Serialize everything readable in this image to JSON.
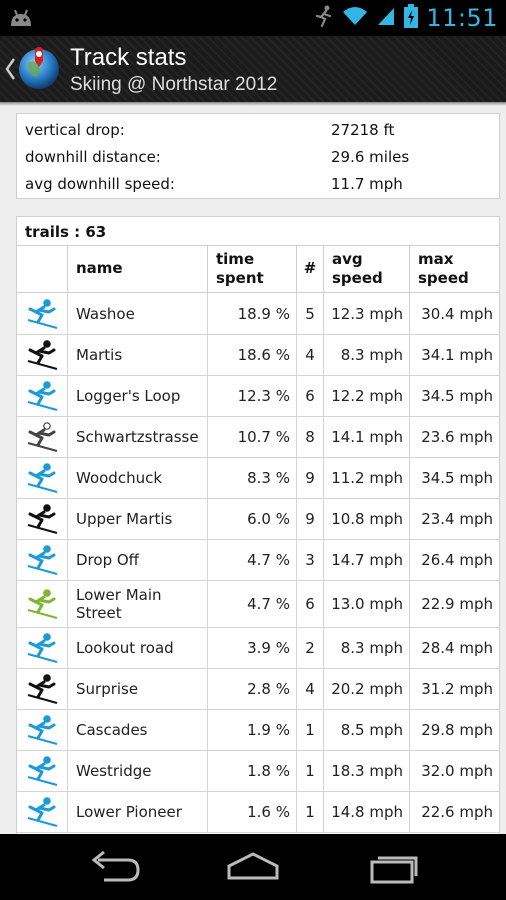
{
  "status_bar": {
    "time": "11:51",
    "icons": [
      "android-debug-icon",
      "running-activity-icon",
      "wifi-icon",
      "cell-signal-icon",
      "battery-charging-icon"
    ]
  },
  "action_bar": {
    "title": "Track stats",
    "subtitle": "Skiing @ Northstar 2012",
    "icons": [
      "up-chevron-icon",
      "app-globe-logo-icon"
    ]
  },
  "summary": [
    {
      "label": "vertical drop:",
      "value": "27218 ft"
    },
    {
      "label": "downhill distance:",
      "value": "29.6 miles"
    },
    {
      "label": "avg downhill speed:",
      "value": "11.7 mph"
    }
  ],
  "trails": {
    "header": "trails : 63",
    "columns": {
      "icon": "",
      "name": "name",
      "time_line1": "time",
      "time_line2": "spent",
      "count": "#",
      "avg_line1": "avg",
      "avg_line2": "speed",
      "max_line1": "max",
      "max_line2": "speed"
    },
    "rows": [
      {
        "name": "Washoe",
        "time": "18.9 %",
        "count": "5",
        "avg": "12.3 mph",
        "max": "30.4 mph",
        "difficulty": "blue"
      },
      {
        "name": "Martis",
        "time": "18.6 %",
        "count": "4",
        "avg": "8.3 mph",
        "max": "34.1 mph",
        "difficulty": "black"
      },
      {
        "name": "Logger's Loop",
        "time": "12.3 %",
        "count": "6",
        "avg": "12.2 mph",
        "max": "34.5 mph",
        "difficulty": "blue"
      },
      {
        "name": "Schwartzstrasse",
        "time": "10.7 %",
        "count": "8",
        "avg": "14.1 mph",
        "max": "23.6 mph",
        "difficulty": "outline"
      },
      {
        "name": "Woodchuck",
        "time": "8.3 %",
        "count": "9",
        "avg": "11.2 mph",
        "max": "34.5 mph",
        "difficulty": "blue"
      },
      {
        "name": "Upper Martis",
        "time": "6.0 %",
        "count": "9",
        "avg": "10.8 mph",
        "max": "23.4 mph",
        "difficulty": "black"
      },
      {
        "name": "Drop Off",
        "time": "4.7 %",
        "count": "3",
        "avg": "14.7 mph",
        "max": "26.4 mph",
        "difficulty": "blue"
      },
      {
        "name": "Lower Main Street",
        "time": "4.7 %",
        "count": "6",
        "avg": "13.0 mph",
        "max": "22.9 mph",
        "difficulty": "green"
      },
      {
        "name": "Lookout road",
        "time": "3.9 %",
        "count": "2",
        "avg": "8.3 mph",
        "max": "28.4 mph",
        "difficulty": "blue"
      },
      {
        "name": "Surprise",
        "time": "2.8 %",
        "count": "4",
        "avg": "20.2 mph",
        "max": "31.2 mph",
        "difficulty": "black"
      },
      {
        "name": "Cascades",
        "time": "1.9 %",
        "count": "1",
        "avg": "8.5 mph",
        "max": "29.8 mph",
        "difficulty": "blue"
      },
      {
        "name": "Westridge",
        "time": "1.8 %",
        "count": "1",
        "avg": "18.3 mph",
        "max": "32.0 mph",
        "difficulty": "blue"
      },
      {
        "name": "Lower Pioneer",
        "time": "1.6 %",
        "count": "1",
        "avg": "14.8 mph",
        "max": "22.6 mph",
        "difficulty": "blue"
      }
    ]
  },
  "difficulty_colors": {
    "blue": "#1a9ad6",
    "black": "#111111",
    "green": "#7cb82f",
    "outline": "#444444"
  },
  "nav_bar": {
    "icons": [
      "back-icon",
      "home-icon",
      "recent-apps-icon"
    ]
  }
}
